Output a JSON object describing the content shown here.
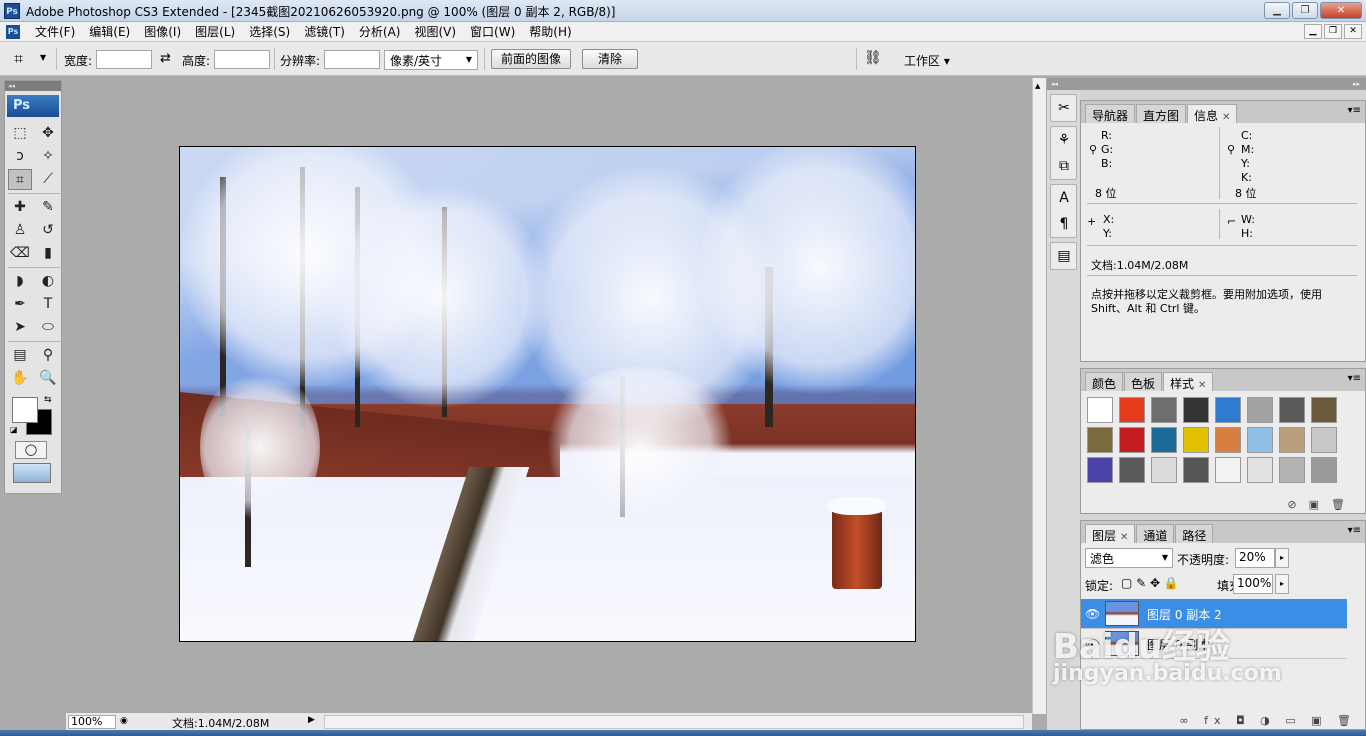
{
  "window": {
    "app_icon": "Ps",
    "title": "Adobe Photoshop CS3 Extended - [2345截图20210626053920.png @ 100% (图层 0 副本 2, RGB/8)]",
    "buttons": [
      "▁",
      "❐",
      "✕"
    ]
  },
  "menubar": {
    "items": [
      "文件(F)",
      "编辑(E)",
      "图像(I)",
      "图层(L)",
      "选择(S)",
      "滤镜(T)",
      "分析(A)",
      "视图(V)",
      "窗口(W)",
      "帮助(H)"
    ],
    "doc_buttons": [
      "▁",
      "❐",
      "✕"
    ]
  },
  "options": {
    "width_label": "宽度:",
    "height_label": "高度:",
    "resolution_label": "分辨率:",
    "unit_select": "像素/英寸",
    "front_image_button": "前面的图像",
    "clear_button": "清除",
    "workspace_label": "工作区 ▾"
  },
  "toolbox": {
    "logo": "Ps",
    "tools": [
      {
        "name": "marquee-tool",
        "glyph": "⬚"
      },
      {
        "name": "move-tool",
        "glyph": "✥"
      },
      {
        "name": "lasso-tool",
        "glyph": "ↄ"
      },
      {
        "name": "magic-wand-tool",
        "glyph": "✧"
      },
      {
        "name": "crop-tool",
        "glyph": "⌗"
      },
      {
        "name": "slice-tool",
        "glyph": "⟋"
      },
      {
        "name": "healing-brush-tool",
        "glyph": "✚"
      },
      {
        "name": "brush-tool",
        "glyph": "✎"
      },
      {
        "name": "clone-stamp-tool",
        "glyph": "♙"
      },
      {
        "name": "history-brush-tool",
        "glyph": "↺"
      },
      {
        "name": "eraser-tool",
        "glyph": "⌫"
      },
      {
        "name": "gradient-tool",
        "glyph": "▮"
      },
      {
        "name": "blur-tool",
        "glyph": "◗"
      },
      {
        "name": "dodge-tool",
        "glyph": "◐"
      },
      {
        "name": "pen-tool",
        "glyph": "✒"
      },
      {
        "name": "type-tool",
        "glyph": "T"
      },
      {
        "name": "path-selection-tool",
        "glyph": "➤"
      },
      {
        "name": "shape-tool",
        "glyph": "⬭"
      },
      {
        "name": "notes-tool",
        "glyph": "▤"
      },
      {
        "name": "eyedropper-tool",
        "glyph": "⚲"
      },
      {
        "name": "hand-tool",
        "glyph": "✋"
      },
      {
        "name": "zoom-tool",
        "glyph": "🔍"
      }
    ],
    "swap_glyph": "⇆",
    "default_glyph": "◪",
    "quickmask_glyph": "◯"
  },
  "status": {
    "zoom": "100%",
    "doc_info": "文档:1.04M/2.08M"
  },
  "dock_icons": [
    "tools-icon",
    "brush-preset-icon",
    "clone-source-icon",
    "character-icon",
    "paragraph-icon",
    "layer-comps-icon"
  ],
  "info_panel": {
    "tabs": [
      "导航器",
      "直方图",
      "信息"
    ],
    "active_tab": "信息",
    "rgb": [
      "R:",
      "G:",
      "B:"
    ],
    "cmyk": [
      "C:",
      "M:",
      "Y:",
      "K:"
    ],
    "bits_left": "8 位",
    "bits_right": "8 位",
    "xy": [
      "X:",
      "Y:"
    ],
    "wh": [
      "W:",
      "H:"
    ],
    "doc": "文档:1.04M/2.08M",
    "hint_line1": "点按并拖移以定义裁剪框。要用附加选项，使用",
    "hint_line2": "Shift、Alt 和 Ctrl 键。"
  },
  "styles_panel": {
    "tabs": [
      "颜色",
      "色板",
      "样式"
    ],
    "active_tab": "样式",
    "swatch_colors": [
      "#ffffff",
      "#e53d1c",
      "#6e6e6e",
      "#333333",
      "#2f7bd1",
      "#a3a3a3",
      "#5a5a5a",
      "#6a5a3a",
      "#7a6a3e",
      "#c51c22",
      "#1c6a9a",
      "#e0c200",
      "#d67f3e",
      "#8fc0e8",
      "#b9a07a",
      "#c8c8c8",
      "#4c43a8",
      "#5a5a5a",
      "#dcdcdc",
      "#555555",
      "#f2f2f2",
      "#e2e2e2",
      "#b4b4b4",
      "#9a9a9a"
    ]
  },
  "layers_panel": {
    "tabs": [
      "图层",
      "通道",
      "路径"
    ],
    "active_tab": "图层",
    "blend_mode": "滤色",
    "opacity_label": "不透明度:",
    "opacity_value": "20%",
    "lock_label": "锁定:",
    "fill_label": "填充:",
    "fill_value": "100%",
    "layers": [
      {
        "name": "图层 0 副本 2",
        "selected": true
      },
      {
        "name": "图层 0 副本",
        "selected": false
      }
    ],
    "footer_icons": "∞ fx ◘ ◑ ▭ ▣ 🗑"
  },
  "watermark": {
    "brand": "Baidu经验",
    "url": "jingyan.baidu.com"
  }
}
